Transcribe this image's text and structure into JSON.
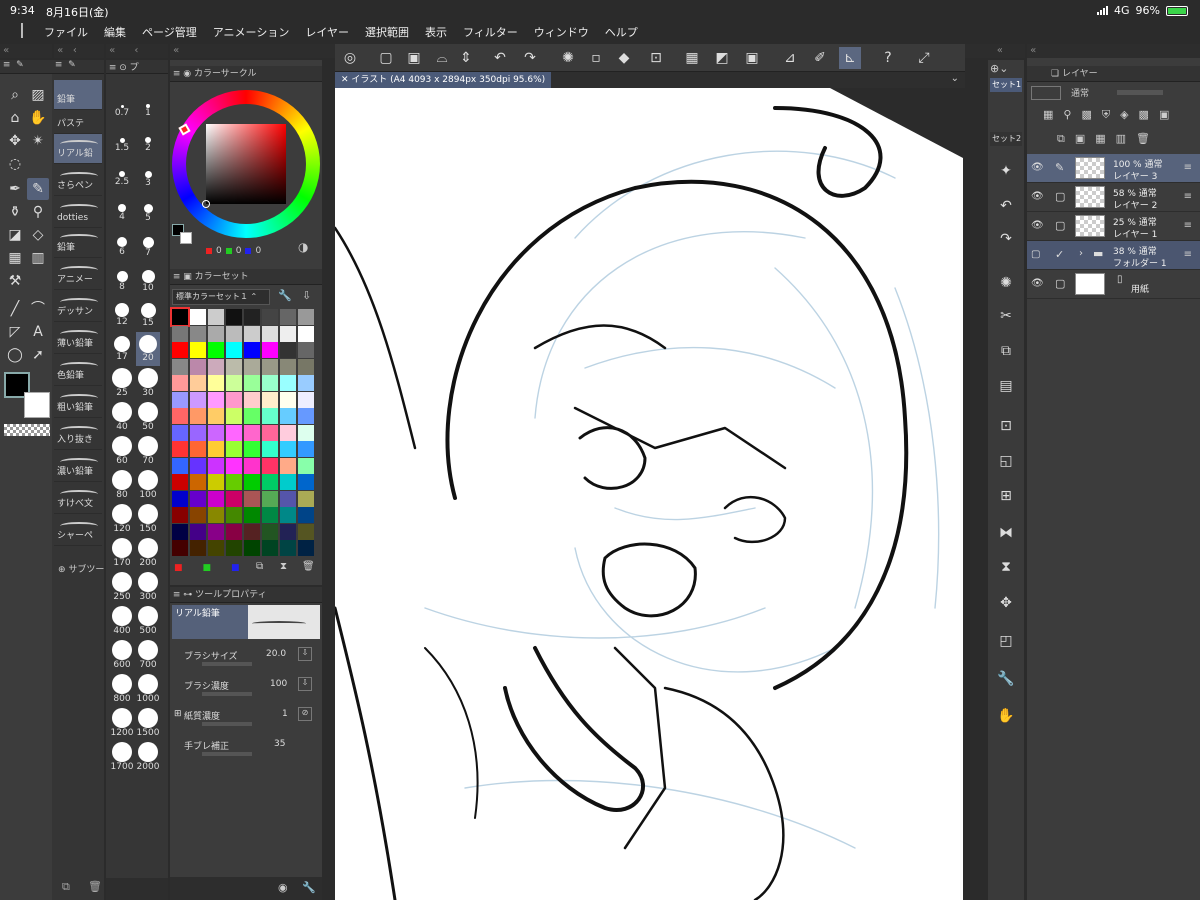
{
  "status": {
    "time": "9:34",
    "date": "8月16日(金)",
    "network": "4G",
    "battery": "96%"
  },
  "menu": [
    "ファイル",
    "編集",
    "ページ管理",
    "アニメーション",
    "レイヤー",
    "選択範囲",
    "表示",
    "フィルター",
    "ウィンドウ",
    "ヘルプ"
  ],
  "subtools": [
    "鉛筆",
    "パステ",
    "リアル鉛",
    "さらペン",
    "dotties",
    "鉛筆",
    "アニメー",
    "デッサン",
    "薄い鉛筆",
    "色鉛筆",
    "粗い鉛筆",
    "入り抜き",
    "濃い鉛筆",
    "すけべ文",
    "シャーペ"
  ],
  "subtool_add": "サブツー",
  "brush_sizes": [
    "0.7",
    "1",
    "1.5",
    "2",
    "2.5",
    "3",
    "4",
    "5",
    "6",
    "7",
    "8",
    "10",
    "12",
    "15",
    "17",
    "20",
    "25",
    "30",
    "40",
    "50",
    "60",
    "70",
    "80",
    "100",
    "120",
    "150",
    "170",
    "200",
    "250",
    "300",
    "400",
    "500",
    "600",
    "700",
    "800",
    "1000",
    "1200",
    "1500",
    "1700",
    "2000"
  ],
  "color_circle": {
    "title": "カラーサークル",
    "r": "0",
    "g": "0",
    "b": "0"
  },
  "color_set": {
    "title": "カラーセット",
    "preset": "標準カラーセット１"
  },
  "tool_property": {
    "title": "ツールプロパティ",
    "brush_name": "リアル鉛筆",
    "rows": [
      {
        "label": "ブラシサイズ",
        "value": "20.0"
      },
      {
        "label": "ブラシ濃度",
        "value": "100"
      },
      {
        "label": "紙質濃度",
        "value": "1"
      },
      {
        "label": "手ブレ補正",
        "value": "35"
      }
    ]
  },
  "canvas_tab": "イラスト (A4 4093 x 2894px 350dpi 95.6%)",
  "right_cmd": {
    "set1": "セット1",
    "set2": "セット2"
  },
  "layers": {
    "title": "レイヤー",
    "blend": "通常",
    "items": [
      {
        "l1": "100 %  通常",
        "l2": "レイヤー 3"
      },
      {
        "l1": "58 %  通常",
        "l2": "レイヤー 2"
      },
      {
        "l1": "25 %  通常",
        "l2": "レイヤー 1"
      },
      {
        "l1": "38 %  通常",
        "l2": "フォルダー 1"
      },
      {
        "l1": "用紙",
        "l2": ""
      }
    ]
  },
  "colors": {
    "accent": "#5b6780",
    "panel": "#3c3c3c"
  }
}
